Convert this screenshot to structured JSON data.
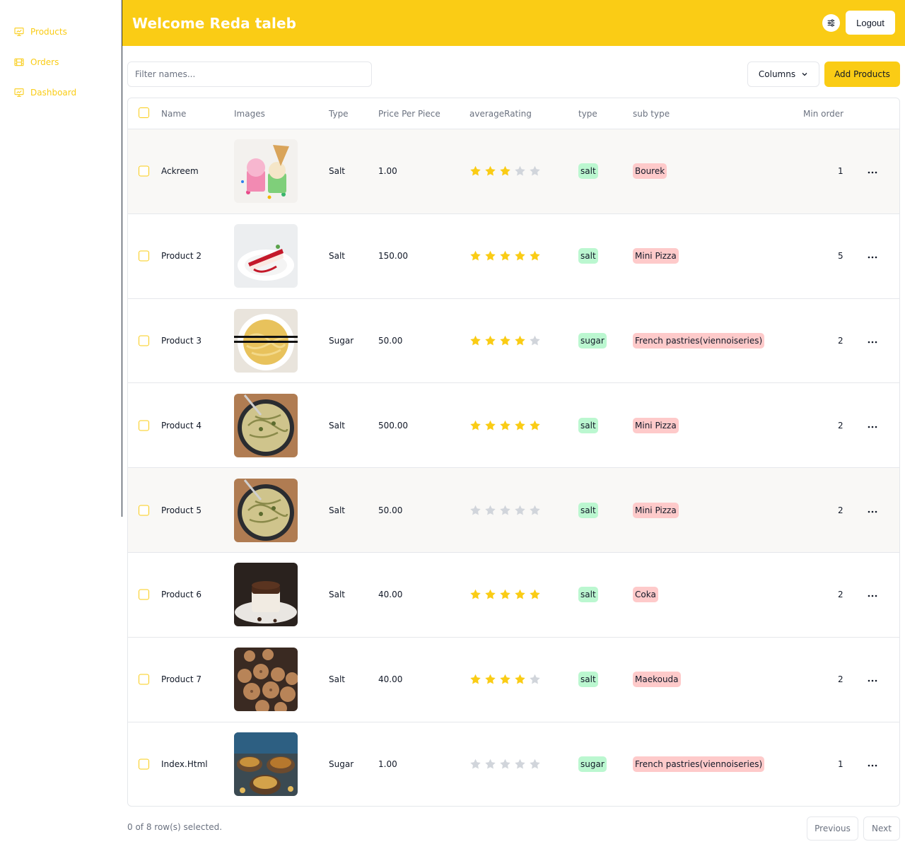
{
  "sidebar": {
    "items": [
      {
        "label": "Products",
        "icon": "presentation-chart-icon"
      },
      {
        "label": "Orders",
        "icon": "film-icon"
      },
      {
        "label": "Dashboard",
        "icon": "presentation-chart-icon"
      }
    ]
  },
  "header": {
    "title": "Welcome Reda taleb",
    "settings_icon": "sliders-icon",
    "logout_label": "Logout"
  },
  "toolbar": {
    "filter_placeholder": "Filter names...",
    "columns_label": "Columns",
    "add_label": "Add Products"
  },
  "table": {
    "headers": {
      "name": "Name",
      "images": "Images",
      "type": "Type",
      "price": "Price Per Piece",
      "rating": "averageRating",
      "type2": "type",
      "subtype": "sub type",
      "min_order": "Min order"
    },
    "rows": [
      {
        "name": "Ackreem",
        "image": "ice-cream",
        "type": "Salt",
        "price": "1.00",
        "rating": 3,
        "type_badge": "salt",
        "subtype": "Bourek",
        "min_order": "1"
      },
      {
        "name": "Product 2",
        "image": "cake-slice",
        "type": "Salt",
        "price": "150.00",
        "rating": 5,
        "type_badge": "salt",
        "subtype": "Mini Pizza",
        "min_order": "5"
      },
      {
        "name": "Product 3",
        "image": "noodle-bowl",
        "type": "Sugar",
        "price": "50.00",
        "rating": 4,
        "type_badge": "sugar",
        "subtype": "French pastries(viennoiseries)",
        "min_order": "2"
      },
      {
        "name": "Product 4",
        "image": "pasta-pan",
        "type": "Salt",
        "price": "500.00",
        "rating": 5,
        "type_badge": "salt",
        "subtype": "Mini Pizza",
        "min_order": "2"
      },
      {
        "name": "Product 5",
        "image": "pasta-pan",
        "type": "Salt",
        "price": "50.00",
        "rating": 0,
        "type_badge": "salt",
        "subtype": "Mini Pizza",
        "min_order": "2"
      },
      {
        "name": "Product 6",
        "image": "chocolate-cake",
        "type": "Salt",
        "price": "40.00",
        "rating": 5,
        "type_badge": "salt",
        "subtype": "Coka",
        "min_order": "2"
      },
      {
        "name": "Product 7",
        "image": "truffles",
        "type": "Salt",
        "price": "40.00",
        "rating": 4,
        "type_badge": "salt",
        "subtype": "Maekouda",
        "min_order": "2"
      },
      {
        "name": "Index.Html",
        "image": "food-platters",
        "type": "Sugar",
        "price": "1.00",
        "rating": 0,
        "type_badge": "sugar",
        "subtype": "French pastries(viennoiseries)",
        "min_order": "1"
      }
    ]
  },
  "footer": {
    "selection_text": "0 of 8 row(s) selected.",
    "previous_label": "Previous",
    "next_label": "Next"
  },
  "colors": {
    "accent": "#facc15",
    "star_filled": "#facc15",
    "star_empty": "#d1d5db",
    "badge_green": "#bbf7d0",
    "badge_red": "#fecaca"
  }
}
